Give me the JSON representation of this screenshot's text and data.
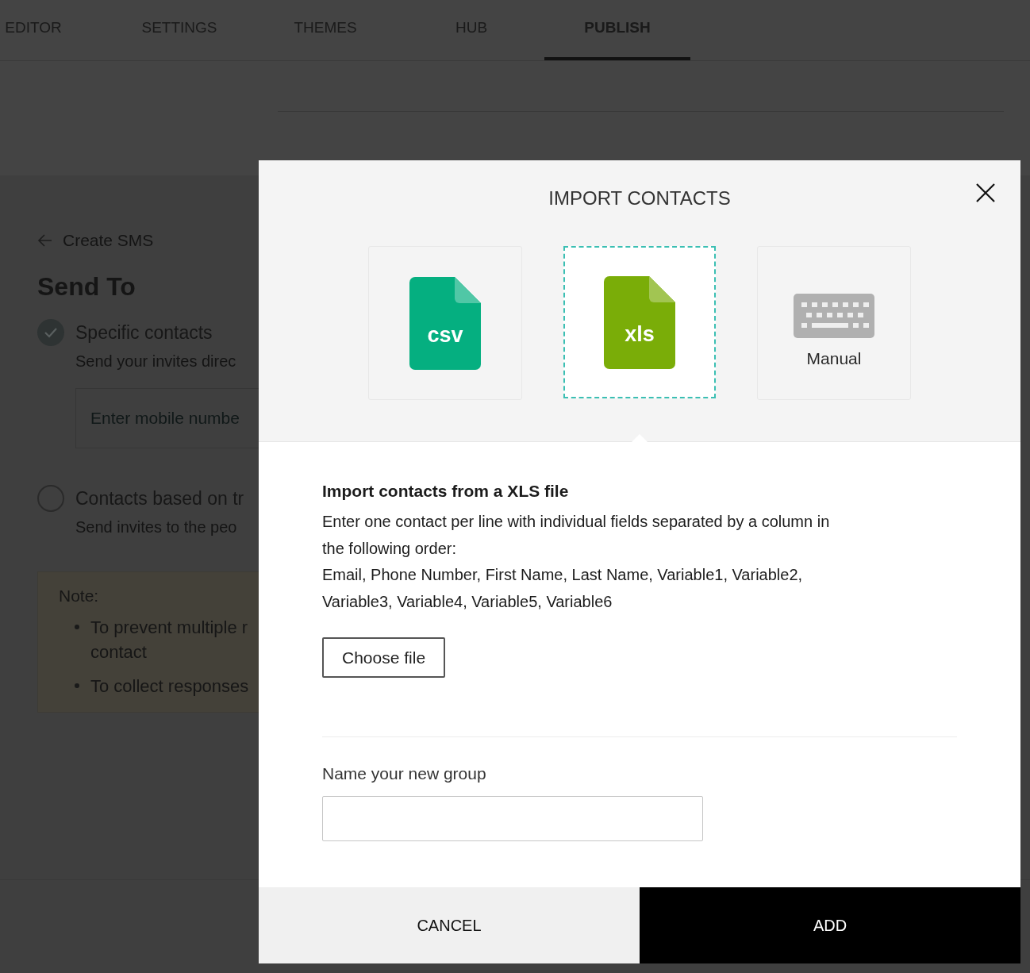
{
  "tabs": [
    {
      "label": "EDITOR",
      "selected": false
    },
    {
      "label": "SETTINGS",
      "selected": false
    },
    {
      "label": "THEMES",
      "selected": false
    },
    {
      "label": "HUB",
      "selected": false
    },
    {
      "label": "PUBLISH",
      "selected": true
    }
  ],
  "background_page": {
    "back_link": "Create SMS",
    "heading": "Send To",
    "options": [
      {
        "label": "Specific contacts",
        "description": "Send your invites direc",
        "selected": true,
        "placeholder": "Enter mobile numbe"
      },
      {
        "label": "Contacts based on tr",
        "description": "Send invites to the peo",
        "selected": false
      }
    ],
    "note": {
      "title": "Note:",
      "items": [
        {
          "lines": [
            "To prevent multiple r",
            "contact"
          ]
        },
        {
          "lines": [
            "To collect responses"
          ]
        }
      ]
    }
  },
  "dialog": {
    "title": "IMPORT CONTACTS",
    "sources": [
      {
        "kind": "file",
        "label": "csv",
        "color": "#05af80",
        "selected": false
      },
      {
        "kind": "file",
        "label": "xls",
        "color": "#7aad08",
        "selected": true
      },
      {
        "kind": "keyboard",
        "label": "Manual",
        "selected": false
      }
    ],
    "heading": "Import contacts from a XLS file",
    "description": "Enter one contact per line with individual fields separated by a column in the following order:",
    "fields_order": "Email, Phone Number, First Name, Last Name, Variable1, Variable2, Variable3, Variable4, Variable5, Variable6",
    "choose_button": "Choose file",
    "group_label": "Name your new group",
    "cancel_button": "CANCEL",
    "add_button": "ADD"
  }
}
